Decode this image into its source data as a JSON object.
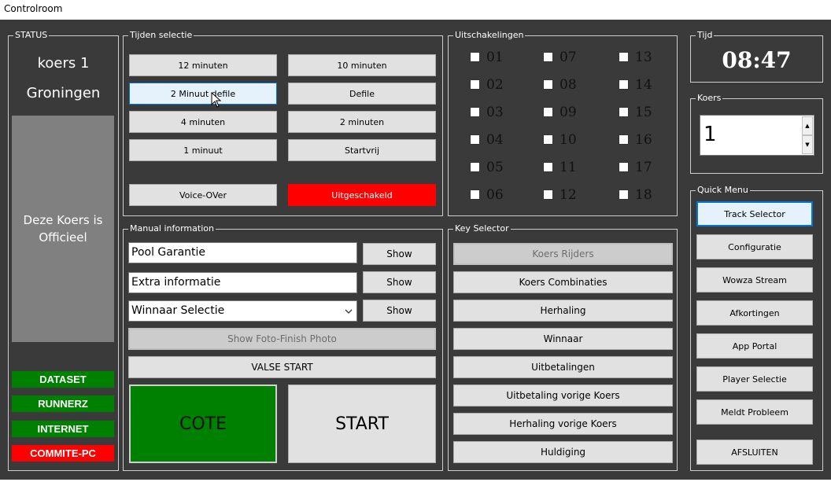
{
  "window": {
    "title": "Controlroom"
  },
  "colors": {
    "background": "#3a3a3a",
    "green": "#008000",
    "red": "#ff0000",
    "panel_gray": "#808080"
  },
  "status": {
    "legend": "STATUS",
    "race": "koers 1",
    "location": "Groningen",
    "official_text": "Deze Koers is Officieel",
    "indicators": [
      {
        "label": "DATASET",
        "color": "#008000"
      },
      {
        "label": "RUNNERZ",
        "color": "#008000"
      },
      {
        "label": "INTERNET",
        "color": "#008000"
      },
      {
        "label": "COMMITE-PC",
        "color": "#ff0000"
      }
    ]
  },
  "tijden": {
    "legend": "Tijden selectie",
    "buttons": [
      "12 minuten",
      "10 minuten",
      "2 Minuut defile",
      "Defile",
      "4 minuten",
      "2 minuten",
      "1 minuut",
      "Startvrij",
      "Voice-OVer",
      "Uitgeschakeld"
    ]
  },
  "uitschakelingen": {
    "legend": "Uitschakelingen",
    "items": [
      "01",
      "02",
      "03",
      "04",
      "05",
      "06",
      "07",
      "08",
      "09",
      "10",
      "11",
      "12",
      "13",
      "14",
      "15",
      "16",
      "17",
      "18"
    ]
  },
  "tijd": {
    "legend": "Tijd",
    "value": "08:47"
  },
  "koers": {
    "legend": "Koers",
    "value": "1"
  },
  "quick_menu": {
    "legend": "Quick Menu",
    "items": [
      "Track Selector",
      "Configuratie",
      "Wowza Stream",
      "Afkortingen",
      "App Portal",
      "Player Selectie",
      "Meldt Probleem"
    ],
    "close": "AFSLUITEN"
  },
  "manual": {
    "legend": "Manual information",
    "pool_value": "Pool Garantie",
    "extra_value": "Extra informatie",
    "winner_value": "Winnaar Selectie",
    "show_label": "Show",
    "foto_finish": "Show Foto-Finish Photo",
    "valse_start": "VALSE START",
    "cote": "COTE",
    "start": "START"
  },
  "key_selector": {
    "legend": "Key Selector",
    "items": [
      "Koers Rijders",
      "Koers Combinaties",
      "Herhaling",
      "Winnaar",
      "Uitbetalingen",
      "Uitbetaling vorige Koers",
      "Herhaling vorige Koers",
      "Huldiging"
    ]
  }
}
